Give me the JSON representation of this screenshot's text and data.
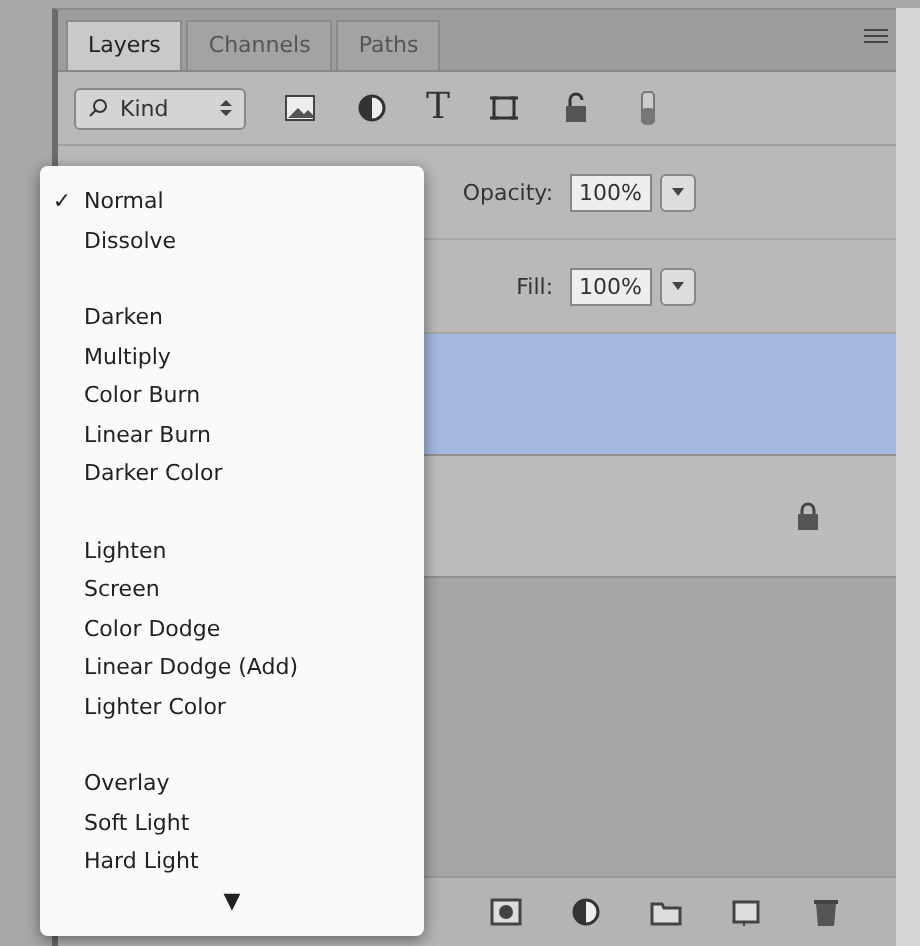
{
  "tabs": [
    {
      "label": "Layers",
      "selected": true
    },
    {
      "label": "Channels",
      "selected": false
    },
    {
      "label": "Paths",
      "selected": false
    }
  ],
  "filter": {
    "kind": "Kind",
    "tools": [
      {
        "kind": "image"
      },
      {
        "kind": "adjustment"
      },
      {
        "kind": "type",
        "glyph": "T"
      },
      {
        "kind": "shape"
      },
      {
        "kind": "smart"
      },
      {
        "kind": "toggle"
      }
    ]
  },
  "opacity": {
    "label": "Opacity:",
    "value": "100%"
  },
  "fill": {
    "label": "Fill:",
    "value": "100%"
  },
  "layers": [
    {
      "selected": true,
      "locked": false
    },
    {
      "selected": false,
      "locked": true
    }
  ],
  "blend_menu": {
    "groups": [
      [
        {
          "label": "Normal",
          "checked": true
        },
        {
          "label": "Dissolve",
          "checked": false
        }
      ],
      [
        {
          "label": "Darken",
          "checked": false
        },
        {
          "label": "Multiply",
          "checked": false
        },
        {
          "label": "Color Burn",
          "checked": false
        },
        {
          "label": "Linear Burn",
          "checked": false
        },
        {
          "label": "Darker Color",
          "checked": false
        }
      ],
      [
        {
          "label": "Lighten",
          "checked": false
        },
        {
          "label": "Screen",
          "checked": false
        },
        {
          "label": "Color Dodge",
          "checked": false
        },
        {
          "label": "Linear Dodge (Add)",
          "checked": false
        },
        {
          "label": "Lighter Color",
          "checked": false
        }
      ],
      [
        {
          "label": "Overlay",
          "checked": false
        },
        {
          "label": "Soft Light",
          "checked": false
        },
        {
          "label": "Hard Light",
          "checked": false
        }
      ]
    ],
    "check_glyph": "✓",
    "more": "▼"
  },
  "bottom_tools": [
    {
      "kind": "mask"
    },
    {
      "kind": "adjustment"
    },
    {
      "kind": "folder"
    },
    {
      "kind": "new"
    },
    {
      "kind": "trash"
    }
  ]
}
